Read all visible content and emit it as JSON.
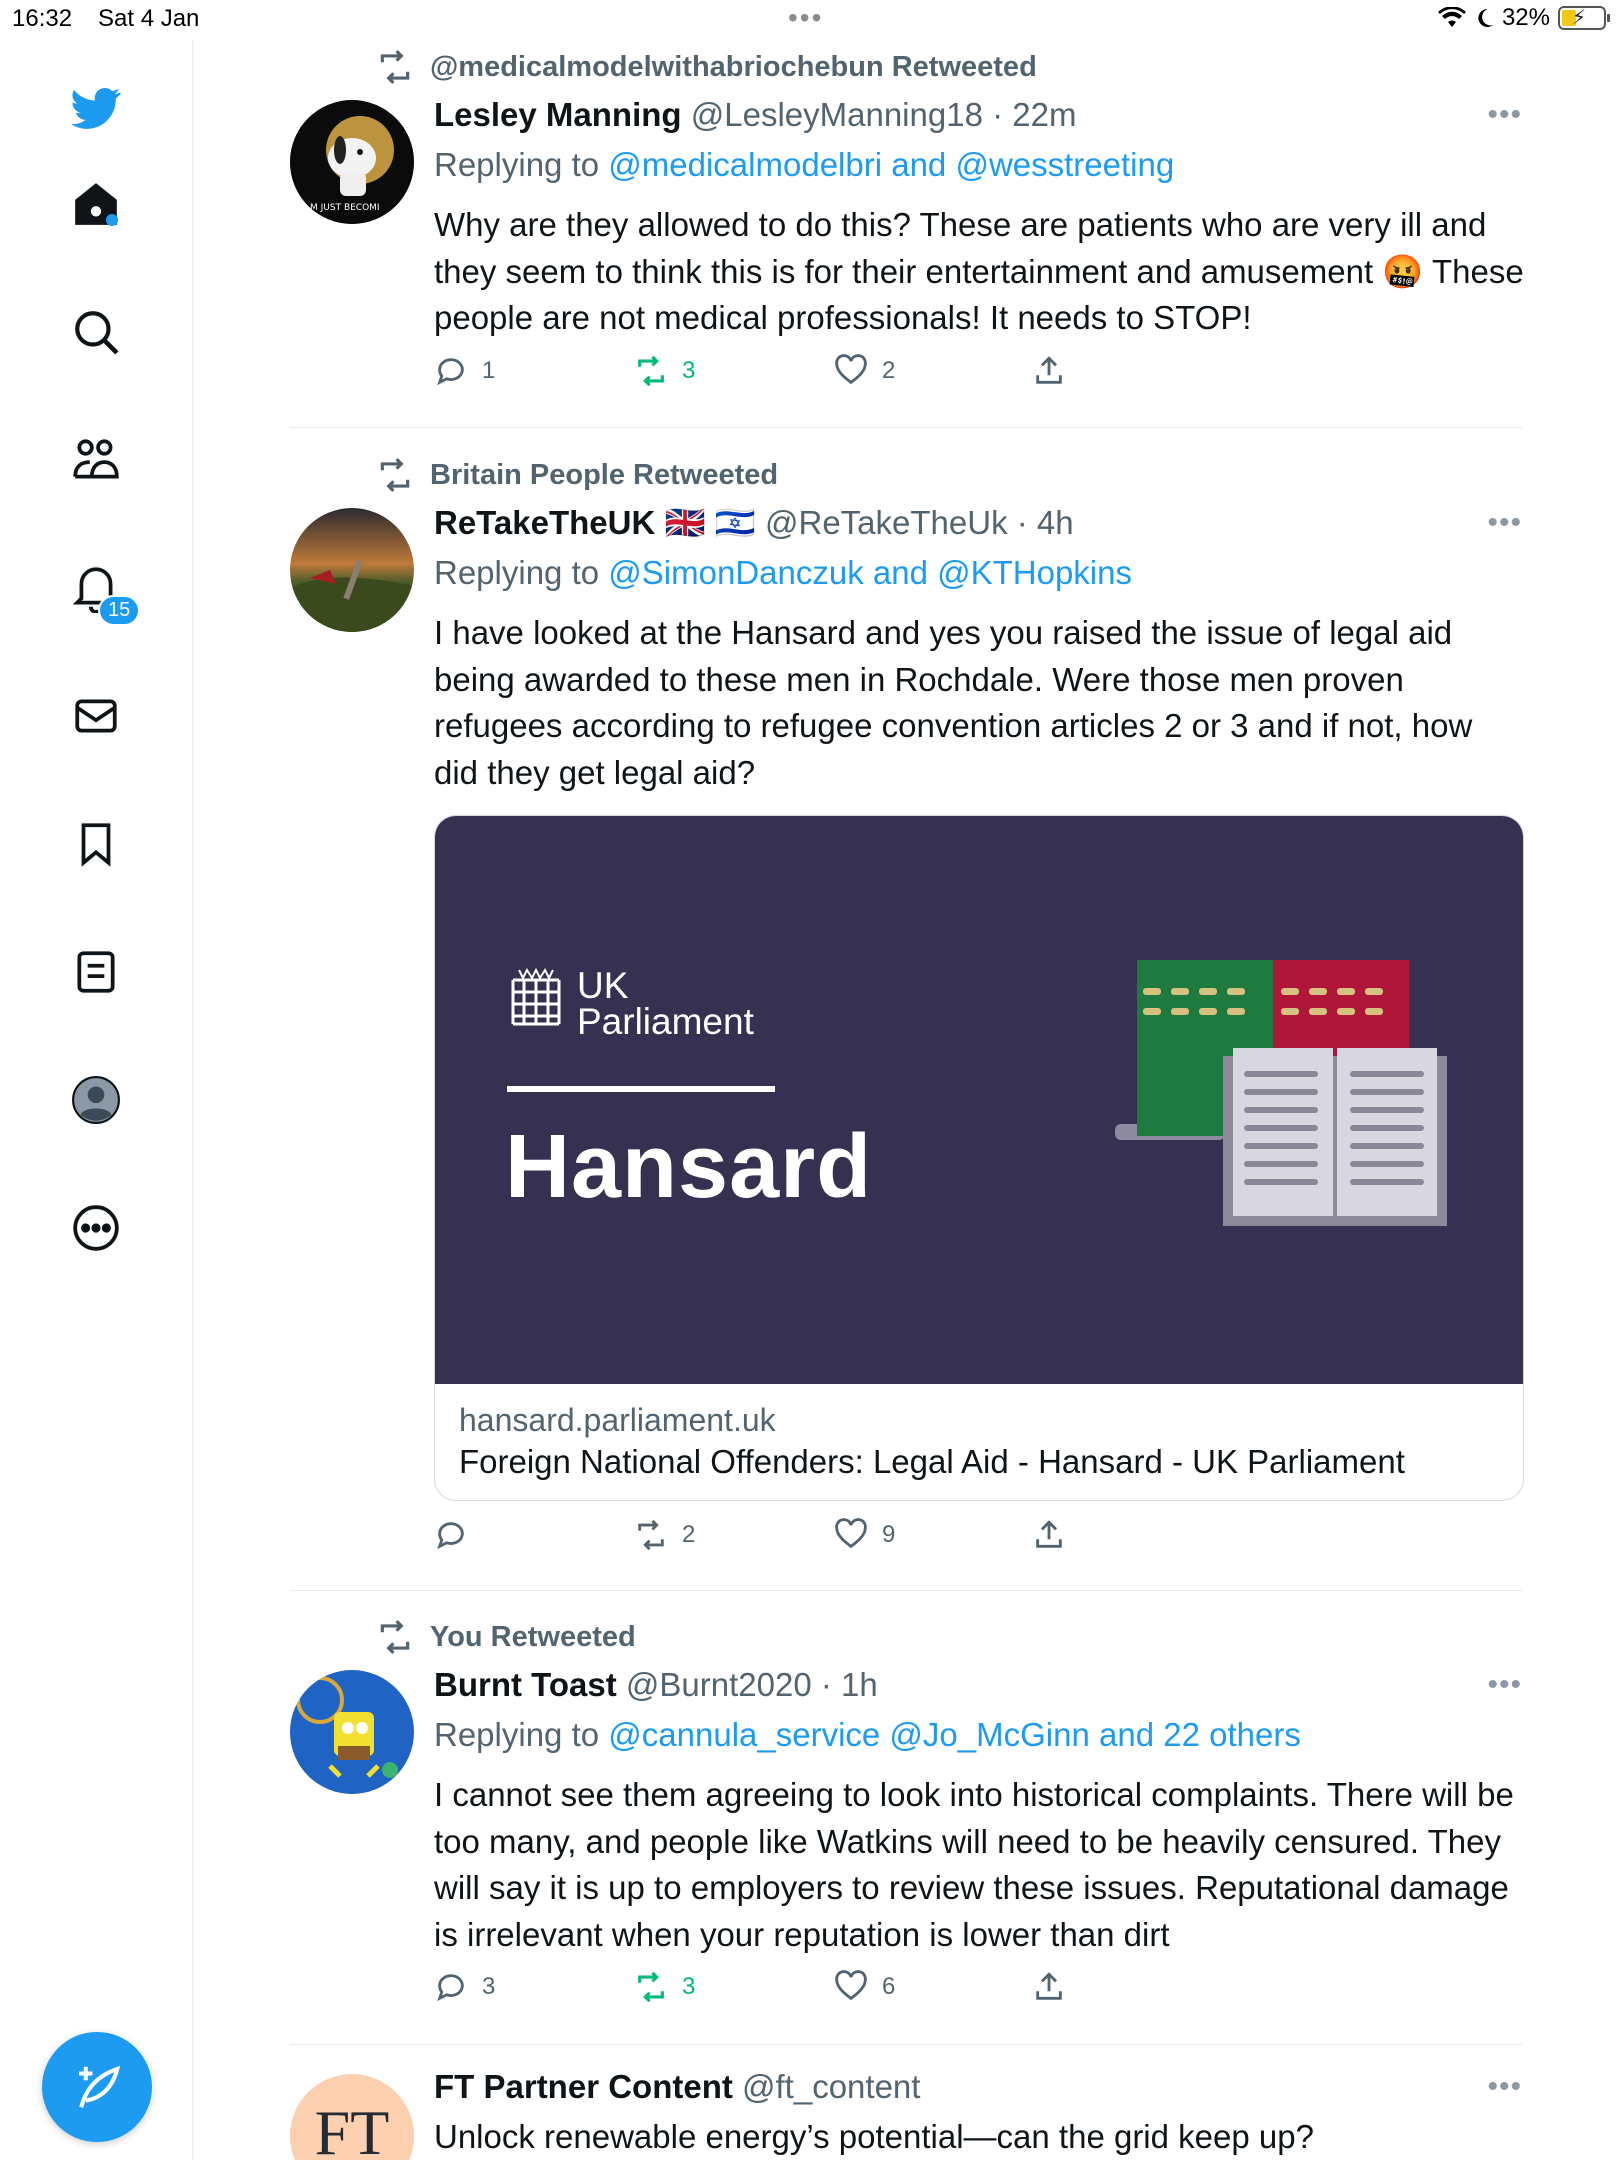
{
  "status_bar": {
    "time": "16:32",
    "date": "Sat 4 Jan",
    "battery": "32%"
  },
  "sidebar": {
    "notifications_badge": "15"
  },
  "tweets": [
    {
      "retweeted_by": "@medicalmodelwithabriochebun Retweeted",
      "name": "Lesley Manning",
      "handle": "@LesleyManning18 · 22m",
      "replying_prefix": "Replying to",
      "replying_to": "@medicalmodelbri and @wesstreeting",
      "body": "Why are they allowed to do this?  These are patients who are very ill and they seem to think this is for their entertainment and amusement 🤬 These people are not medical professionals!  It needs to STOP!",
      "replies": "1",
      "retweets": "3",
      "likes": "2"
    },
    {
      "retweeted_by": "Britain People Retweeted",
      "name": "ReTakeTheUK 🇬🇧 🇮🇱",
      "handle": "@ReTakeTheUk · 4h",
      "replying_prefix": "Replying to",
      "replying_to": "@SimonDanczuk and @KTHopkins",
      "body": "I have looked at the Hansard and yes you raised the issue of legal aid being awarded to these men in Rochdale. Were those men proven refugees according to refugee convention articles 2 or 3 and if not, how did they get legal aid?",
      "card": {
        "logo_line1": "UK",
        "logo_line2": "Parliament",
        "headline": "Hansard",
        "domain": "hansard.parliament.uk",
        "title": "Foreign National Offenders: Legal Aid - Hansard - UK Parliament"
      },
      "replies": "",
      "retweets": "2",
      "likes": "9"
    },
    {
      "retweeted_by": "You Retweeted",
      "name": "Burnt Toast",
      "handle": "@Burnt2020 · 1h",
      "replying_prefix": "Replying to",
      "replying_to": "@cannula_service @Jo_McGinn and 22 others",
      "body": "I cannot see them agreeing to look into historical complaints. There will be too many, and people like Watkins will need to be heavily censured. They will say it is up to employers to review these issues. Reputational damage is irrelevant when your reputation is lower than dirt",
      "replies": "3",
      "retweets": "3",
      "likes": "6"
    },
    {
      "avatar_text": "FT",
      "name": "FT Partner Content",
      "handle": "@ft_content",
      "body": "Unlock renewable energy’s potential—can the grid keep up?"
    }
  ],
  "colors": {
    "accent": "#1d9bf0",
    "retweet_green": "#00ba7c",
    "muted": "#536471",
    "card_bg": "#373151"
  }
}
